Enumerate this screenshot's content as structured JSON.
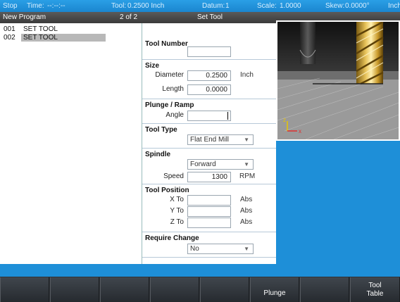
{
  "status_bar": {
    "mode": "Stop",
    "time_label": "Time:",
    "time_value": "--:--:--",
    "tool_label": "Tool:",
    "tool_value": "0.2500 Inch",
    "datum_label": "Datum:",
    "datum_value": "1",
    "scale_label": "Scale:",
    "scale_value": "1.0000",
    "skew_label": "Skew:",
    "skew_value": "0.0000°",
    "units": "Inch"
  },
  "title_bar": {
    "program_name": "New Program",
    "step_indicator": "2 of 2",
    "form_title": "Set Tool"
  },
  "program_steps": [
    {
      "num": "001",
      "label": "SET TOOL",
      "selected": false
    },
    {
      "num": "002",
      "label": "SET TOOL",
      "selected": true
    }
  ],
  "form": {
    "tool_number": {
      "title": "Tool Number",
      "value": ""
    },
    "size": {
      "title": "Size",
      "diameter_label": "Diameter",
      "diameter_value": "0.2500",
      "diameter_unit": "Inch",
      "length_label": "Length",
      "length_value": "0.0000"
    },
    "plunge_ramp": {
      "title": "Plunge / Ramp",
      "angle_label": "Angle",
      "angle_value": ""
    },
    "tool_type": {
      "title": "Tool Type",
      "selected": "Flat End Mill"
    },
    "spindle": {
      "title": "Spindle",
      "direction": "Forward",
      "speed_label": "Speed",
      "speed_value": "1300",
      "speed_unit": "RPM"
    },
    "tool_position": {
      "title": "Tool Position",
      "x_label": "X To",
      "y_label": "Y To",
      "z_label": "Z To",
      "x_value": "",
      "y_value": "",
      "z_value": "",
      "abs_label": "Abs"
    },
    "require_change": {
      "title": "Require Change",
      "selected": "No"
    }
  },
  "preview": {
    "axis_z": "z",
    "axis_x": "x",
    "icon": "end-mill-illustration"
  },
  "softkeys": [
    {
      "line1": "",
      "line2": ""
    },
    {
      "line1": "",
      "line2": ""
    },
    {
      "line1": "",
      "line2": ""
    },
    {
      "line1": "",
      "line2": ""
    },
    {
      "line1": "",
      "line2": ""
    },
    {
      "line1": "Plunge",
      "line2": ""
    },
    {
      "line1": "",
      "line2": ""
    },
    {
      "line1": "Tool",
      "line2": "Table"
    }
  ],
  "colors": {
    "background_blue": "#1e8fd8",
    "selected_row": "#b8b8b8",
    "axis_red": "#e03030",
    "axis_yellow": "#e8c400"
  }
}
